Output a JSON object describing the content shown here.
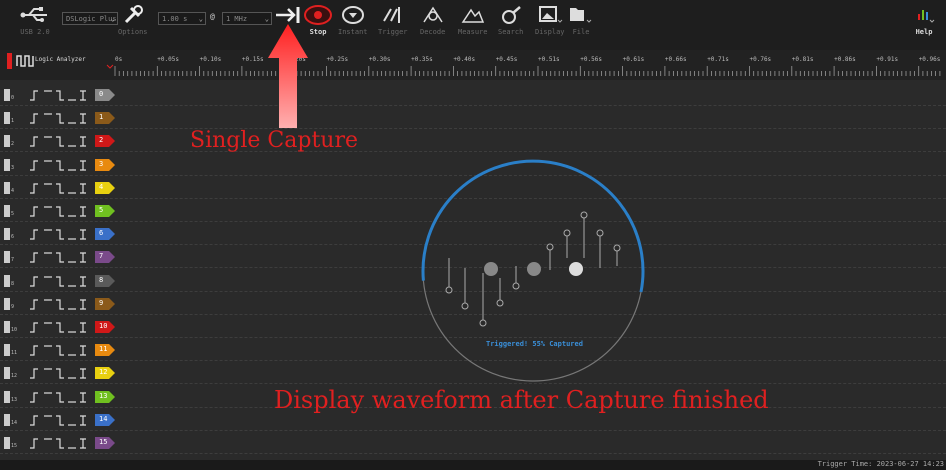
{
  "toolbar": {
    "device_label": "USB 2.0",
    "device_select": "DSLogic Plus",
    "options_label": "Options",
    "samples_value": "1.00 s",
    "rate_value": "1 MHz",
    "start_label": "Stop",
    "instant_label": "Instant",
    "trigger_label": "Trigger",
    "decode_label": "Decode",
    "measure_label": "Measure",
    "search_label": "Search",
    "display_label": "Display",
    "file_label": "File",
    "help_label": "Help"
  },
  "ruler": {
    "mode_label": "Logic Analyzer",
    "ticks": [
      "0s",
      "+0.05s",
      "+0.10s",
      "+0.15s",
      "+0.20s",
      "+0.25s",
      "+0.30s",
      "+0.35s",
      "+0.40s",
      "+0.45s",
      "+0.51s",
      "+0.56s",
      "+0.61s",
      "+0.66s",
      "+0.71s",
      "+0.76s",
      "+0.81s",
      "+0.86s",
      "+0.91s",
      "+0.96s"
    ]
  },
  "channels": [
    {
      "num": "0",
      "color": "#8a8a8a"
    },
    {
      "num": "1",
      "color": "#8b5a1a"
    },
    {
      "num": "2",
      "color": "#d01818"
    },
    {
      "num": "3",
      "color": "#e88a10"
    },
    {
      "num": "4",
      "color": "#e8d010"
    },
    {
      "num": "5",
      "color": "#70c020"
    },
    {
      "num": "6",
      "color": "#3a70c8"
    },
    {
      "num": "7",
      "color": "#7a4a8a"
    },
    {
      "num": "8",
      "color": "#5a5a5a"
    },
    {
      "num": "9",
      "color": "#8b5a1a"
    },
    {
      "num": "10",
      "color": "#d01818"
    },
    {
      "num": "11",
      "color": "#e88a10"
    },
    {
      "num": "12",
      "color": "#e8d010"
    },
    {
      "num": "13",
      "color": "#70c020"
    },
    {
      "num": "14",
      "color": "#3a70c8"
    },
    {
      "num": "15",
      "color": "#7a4a8a"
    }
  ],
  "capture": {
    "progress_text": "Triggered! 55% Captured",
    "progress_fraction": 0.55
  },
  "status": {
    "trigger_time": "Trigger Time: 2023-06-27 14:23"
  },
  "annotations": {
    "single_capture": "Single Capture",
    "display_waveform": "Display waveform after Capture finished"
  },
  "colors": {
    "accent_red": "#e02020",
    "progress_blue": "#2a7fc8"
  }
}
